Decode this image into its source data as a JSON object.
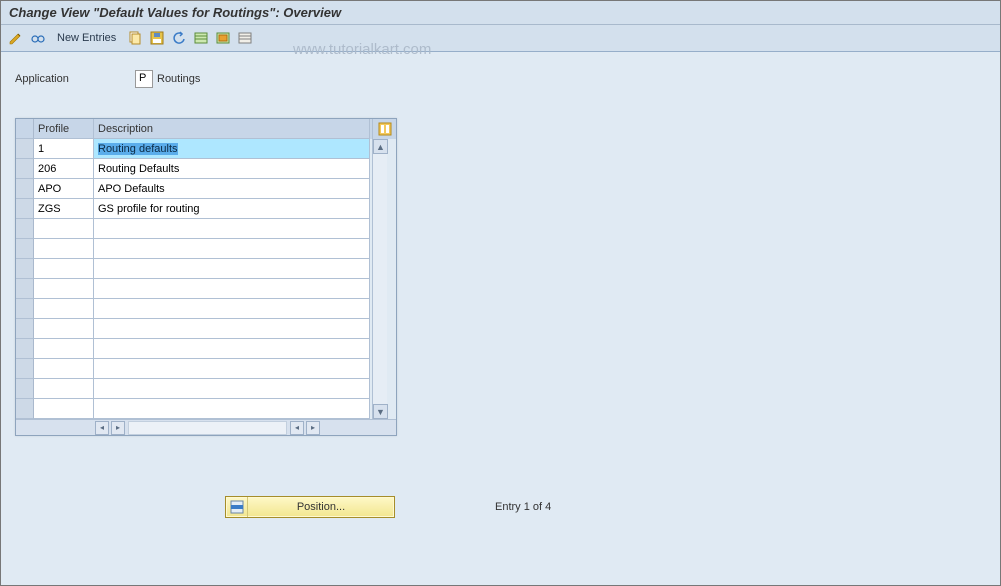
{
  "title": "Change View \"Default Values for Routings\": Overview",
  "watermark": "www.tutorialkart.com",
  "toolbar": {
    "new_entries": "New Entries"
  },
  "app_field": {
    "label": "Application",
    "value": "P",
    "desc": "Routings"
  },
  "columns": {
    "profile": "Profile",
    "description": "Description"
  },
  "rows": [
    {
      "profile": "1",
      "description": "Routing defaults"
    },
    {
      "profile": "206",
      "description": "Routing Defaults"
    },
    {
      "profile": "APO",
      "description": "APO Defaults"
    },
    {
      "profile": "ZGS",
      "description": "GS profile for routing"
    }
  ],
  "footer": {
    "position_label": "Position...",
    "entry_text": "Entry 1 of 4"
  }
}
